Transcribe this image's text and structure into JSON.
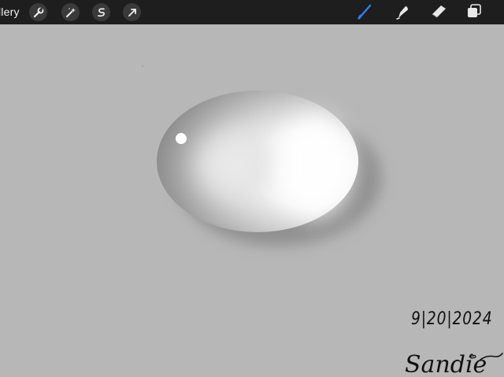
{
  "toolbar": {
    "gallery_label": "llery",
    "left_tools": [
      {
        "icon": "wrench-icon"
      },
      {
        "icon": "magic-wand-icon"
      },
      {
        "icon": "selection-icon"
      },
      {
        "icon": "transform-arrow-icon"
      }
    ],
    "right_tools": [
      {
        "icon": "brush-icon",
        "color": "#2f7ef5"
      },
      {
        "icon": "smudge-icon",
        "color": "#e8e8e8"
      },
      {
        "icon": "eraser-icon",
        "color": "#e8e8e8"
      },
      {
        "icon": "layers-icon",
        "color": "#e8e8e8"
      }
    ]
  },
  "canvas": {
    "background_color": "#b7b7b7",
    "artwork": "water-droplet",
    "date_text": "9|20|2024",
    "signature_text": "Sandie"
  },
  "colors": {
    "toolbar_bg": "#1e1e1e",
    "accent": "#2f7ef5"
  }
}
